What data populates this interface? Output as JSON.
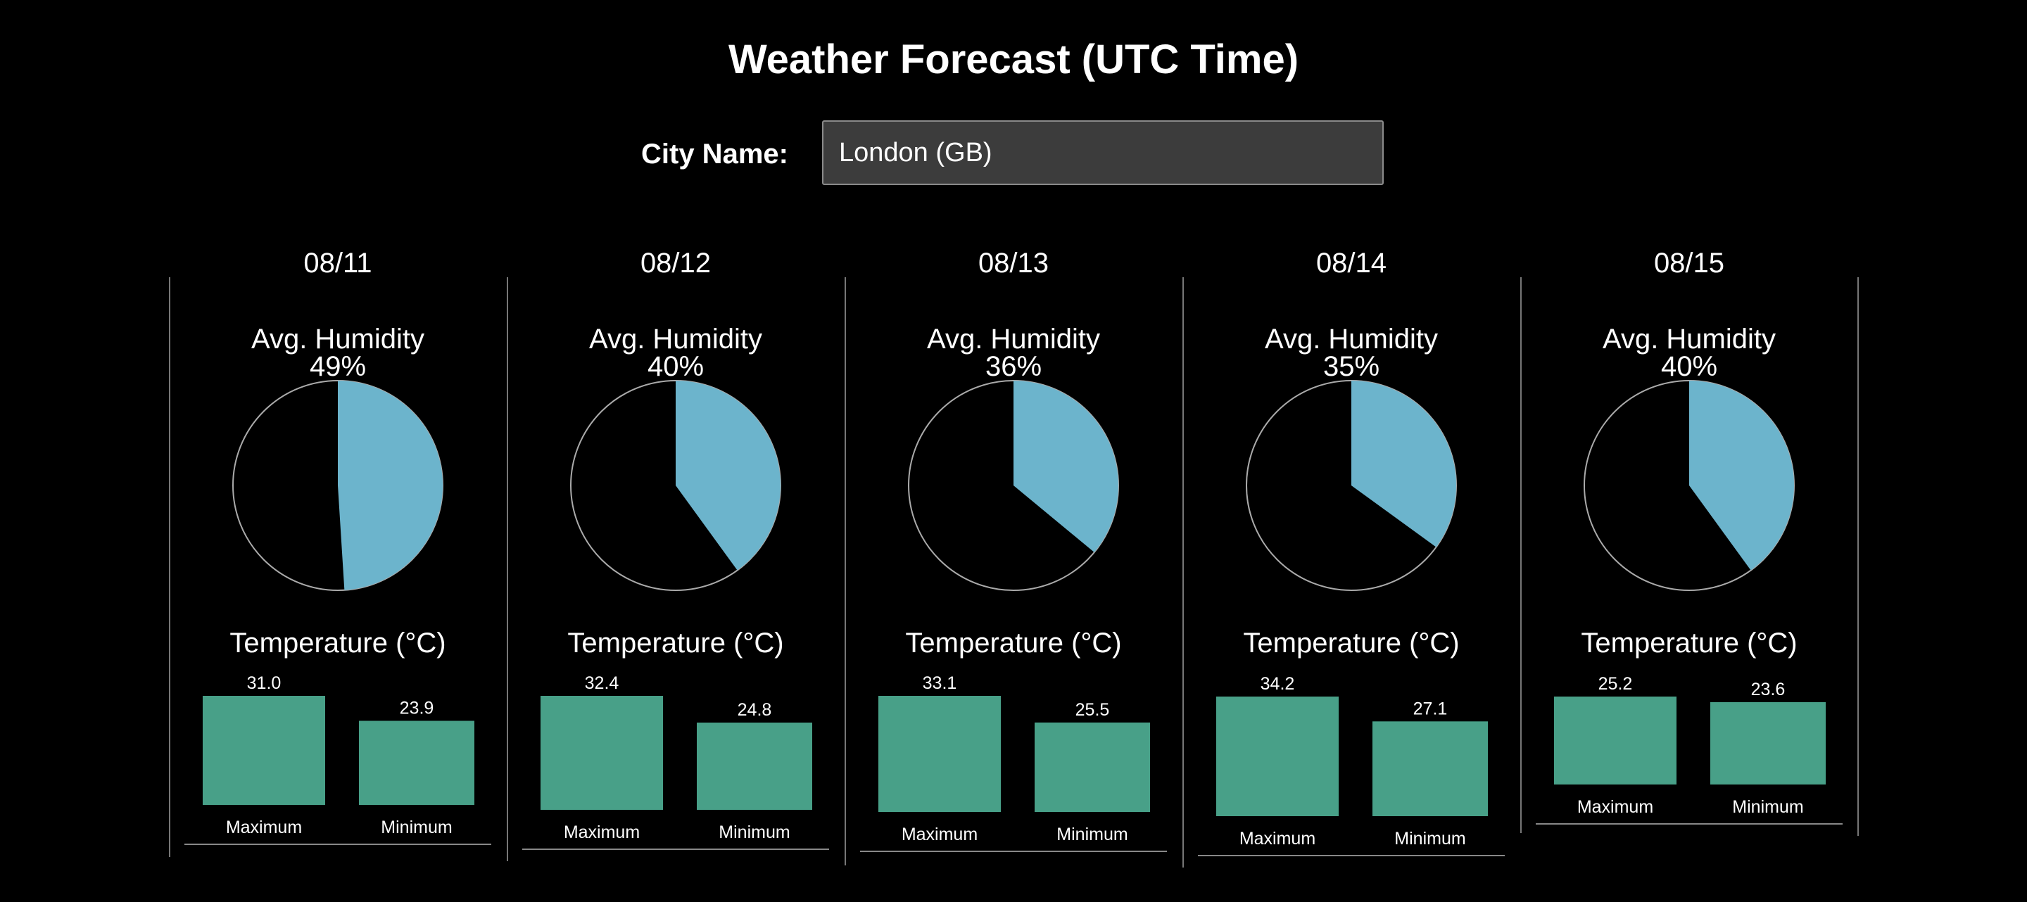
{
  "page": {
    "title": "Weather Forecast (UTC Time)"
  },
  "city": {
    "label": "City Name:",
    "value": "London (GB)"
  },
  "section_titles": {
    "humidity": "Avg. Humidity",
    "temperature": "Temperature (°C)"
  },
  "bar_labels": [
    "Maximum",
    "Minimum"
  ],
  "colors": {
    "background": "#000000",
    "humidity_fill": "#6cb4cc",
    "bar_fill": "#48a088",
    "outline": "#aaaaaa"
  },
  "days": [
    {
      "date": "08/11",
      "humidity_label": "49%",
      "max_label": "31.0",
      "min_label": "23.9"
    },
    {
      "date": "08/12",
      "humidity_label": "40%",
      "max_label": "32.4",
      "min_label": "24.8"
    },
    {
      "date": "08/13",
      "humidity_label": "36%",
      "max_label": "33.1",
      "min_label": "25.5"
    },
    {
      "date": "08/14",
      "humidity_label": "35%",
      "max_label": "34.2",
      "min_label": "27.1"
    },
    {
      "date": "08/15",
      "humidity_label": "40%",
      "max_label": "25.2",
      "min_label": "23.6"
    }
  ],
  "chart_data": [
    {
      "type": "pie",
      "title": "Avg. Humidity",
      "label": "08/11",
      "values": [
        49,
        51
      ]
    },
    {
      "type": "pie",
      "title": "Avg. Humidity",
      "label": "08/12",
      "values": [
        40,
        60
      ]
    },
    {
      "type": "pie",
      "title": "Avg. Humidity",
      "label": "08/13",
      "values": [
        36,
        64
      ]
    },
    {
      "type": "pie",
      "title": "Avg. Humidity",
      "label": "08/14",
      "values": [
        35,
        65
      ]
    },
    {
      "type": "pie",
      "title": "Avg. Humidity",
      "label": "08/15",
      "values": [
        40,
        60
      ]
    },
    {
      "type": "bar",
      "title": "Temperature (°C)",
      "label": "08/11",
      "categories": [
        "Maximum",
        "Minimum"
      ],
      "values": [
        31.0,
        23.9
      ]
    },
    {
      "type": "bar",
      "title": "Temperature (°C)",
      "label": "08/12",
      "categories": [
        "Maximum",
        "Minimum"
      ],
      "values": [
        32.4,
        24.8
      ]
    },
    {
      "type": "bar",
      "title": "Temperature (°C)",
      "label": "08/13",
      "categories": [
        "Maximum",
        "Minimum"
      ],
      "values": [
        33.1,
        25.5
      ]
    },
    {
      "type": "bar",
      "title": "Temperature (°C)",
      "label": "08/14",
      "categories": [
        "Maximum",
        "Minimum"
      ],
      "values": [
        34.2,
        27.1
      ]
    },
    {
      "type": "bar",
      "title": "Temperature (°C)",
      "label": "08/15",
      "categories": [
        "Maximum",
        "Minimum"
      ],
      "values": [
        25.2,
        23.6
      ]
    }
  ]
}
